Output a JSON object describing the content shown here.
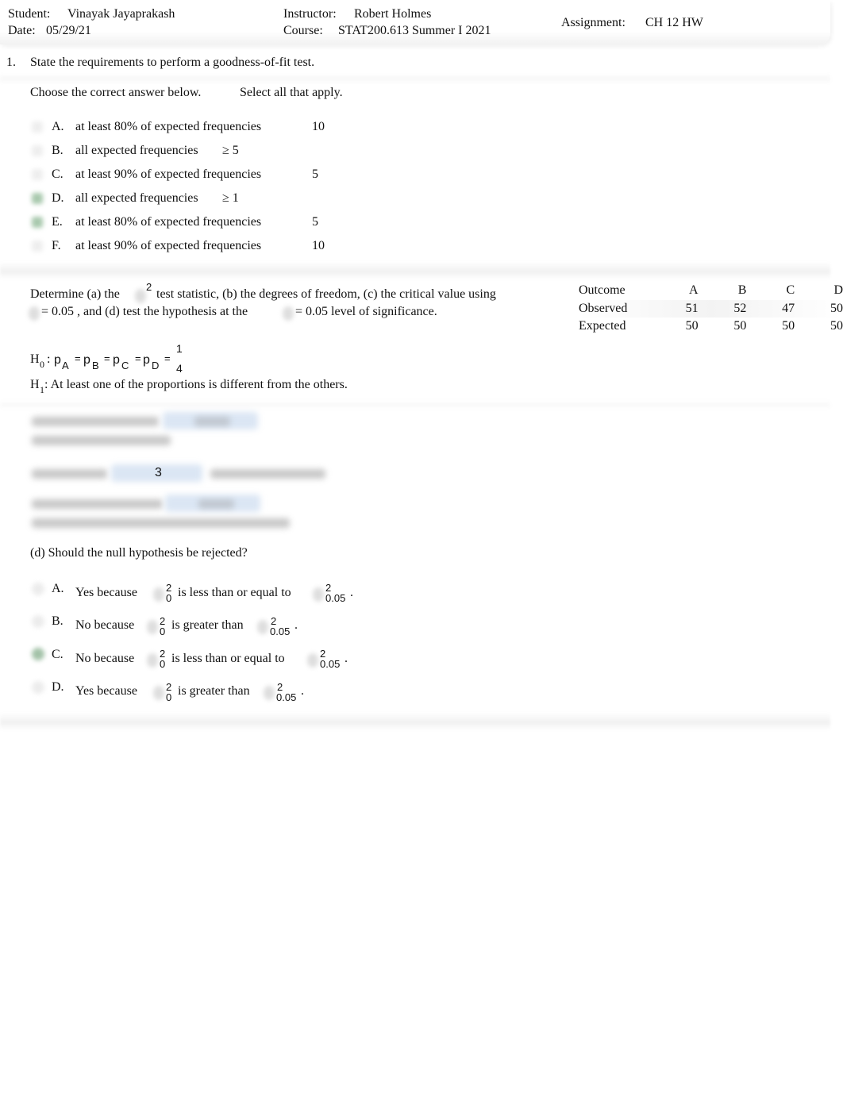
{
  "header": {
    "student_label": "Student:",
    "student_name": "Vinayak Jayaprakash",
    "date_label": "Date:",
    "date_value": "05/29/21",
    "instructor_label": "Instructor:",
    "instructor_name": "Robert Holmes",
    "course_label": "Course:",
    "course_value": "STAT200.613 Summer I 2021",
    "assignment_label": "Assignment:",
    "assignment_value": "CH 12 HW"
  },
  "q1": {
    "number": "1.",
    "prompt": "State the requirements to perform a goodness-of-fit test.",
    "instruction": "Choose the correct answer below.",
    "instruction2": "Select all that apply.",
    "options": [
      {
        "letter": "A.",
        "text": "at least 80% of expected frequencies",
        "value": "10",
        "selected": false
      },
      {
        "letter": "B.",
        "text": "all expected frequencies",
        "value": "≥ 5",
        "selected": false
      },
      {
        "letter": "C.",
        "text": "at least 90% of expected frequencies",
        "value": "5",
        "selected": false
      },
      {
        "letter": "D.",
        "text": "all expected frequencies",
        "value": "≥ 1",
        "selected": true
      },
      {
        "letter": "E.",
        "text": "at least 80% of expected frequencies",
        "value": "5",
        "selected": true
      },
      {
        "letter": "F.",
        "text": "at least 90% of expected frequencies",
        "value": "10",
        "selected": false
      }
    ]
  },
  "q2": {
    "intro_line1_a": "Determine (a) the",
    "intro_sup": "2",
    "intro_line1_b": "test statistic, (b) the degrees of freedom, (c) the critical value using",
    "intro_line2_a": "= 0.05 , and (d) test the hypothesis at the",
    "intro_line2_b": "= 0.05  level of significance.",
    "table": {
      "headers": [
        "Outcome",
        "A",
        "B",
        "C",
        "D"
      ],
      "rows": [
        {
          "label": "Observed",
          "values": [
            "51",
            "52",
            "47",
            "50"
          ]
        },
        {
          "label": "Expected",
          "values": [
            "50",
            "50",
            "50",
            "50"
          ]
        }
      ]
    },
    "h0": {
      "H": "H",
      "sub0": "0",
      "colon": ":",
      "p": "p",
      "subs": [
        "A",
        "B",
        "C",
        "D"
      ],
      "eq": "=",
      "frac_num": "1",
      "frac_den": "4"
    },
    "h1": {
      "H": "H",
      "sub1": "1",
      "text": ": At least one of the proportions is different from the others."
    },
    "part_b_answer": "3",
    "part_d": {
      "question": "(d) Should the null hypothesis be rejected?",
      "sup": "2",
      "sub0": "0",
      "sub_crit": "0.05",
      "period": ".",
      "options": [
        {
          "letter": "A.",
          "lead": "Yes  because",
          "relation": "is less than or equal to",
          "selected": false
        },
        {
          "letter": "B.",
          "lead": "No because",
          "relation": "is  greater than",
          "selected": false
        },
        {
          "letter": "C.",
          "lead": "No because",
          "relation": "is  less than or equal to",
          "selected": true
        },
        {
          "letter": "D.",
          "lead": "Yes  because",
          "relation": "is greater than",
          "selected": false
        }
      ]
    }
  }
}
